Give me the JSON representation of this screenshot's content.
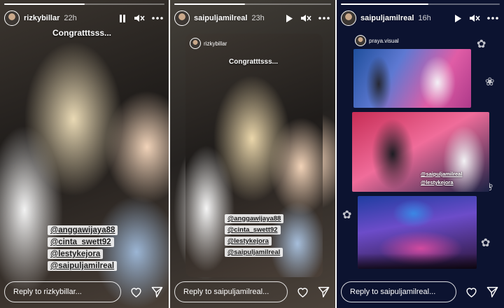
{
  "stories": [
    {
      "username": "rizkybillar",
      "time": "22h",
      "progress": 0.5,
      "caption": "Congratttsss...",
      "mentions": [
        "@anggawijaya88",
        "@cinta_swett92",
        "@lestykejora",
        "@saipuljamilreal"
      ],
      "reply_placeholder": "Reply to rizkybillar..."
    },
    {
      "username": "saipuljamilreal",
      "time": "23h",
      "progress": 0.45,
      "shared_username": "rizkybillar",
      "caption": "Congratttsss...",
      "mentions": [
        "@anggawijaya88",
        "@cinta_swett92",
        "@lestykejora",
        "@saipuljamilreal"
      ],
      "reply_placeholder": "Reply to saipuljamilreal..."
    },
    {
      "username": "saipuljamilreal",
      "time": "16h",
      "progress": 0.55,
      "shared_username": "praya.visual",
      "mini_mentions": [
        "@saipuljamilreal",
        "@lestykejora"
      ],
      "reply_placeholder": "Reply to saipuljamilreal..."
    }
  ],
  "icons": {
    "pause": "pause-icon",
    "play": "play-icon",
    "mute": "speaker-muted-icon",
    "more": "more-horizontal-icon",
    "like": "heart-icon",
    "share": "send-icon"
  },
  "colors": {
    "text": "#ffffff",
    "tag_bg": "#ffffffd9",
    "panel3_bg": "#0c1330"
  }
}
